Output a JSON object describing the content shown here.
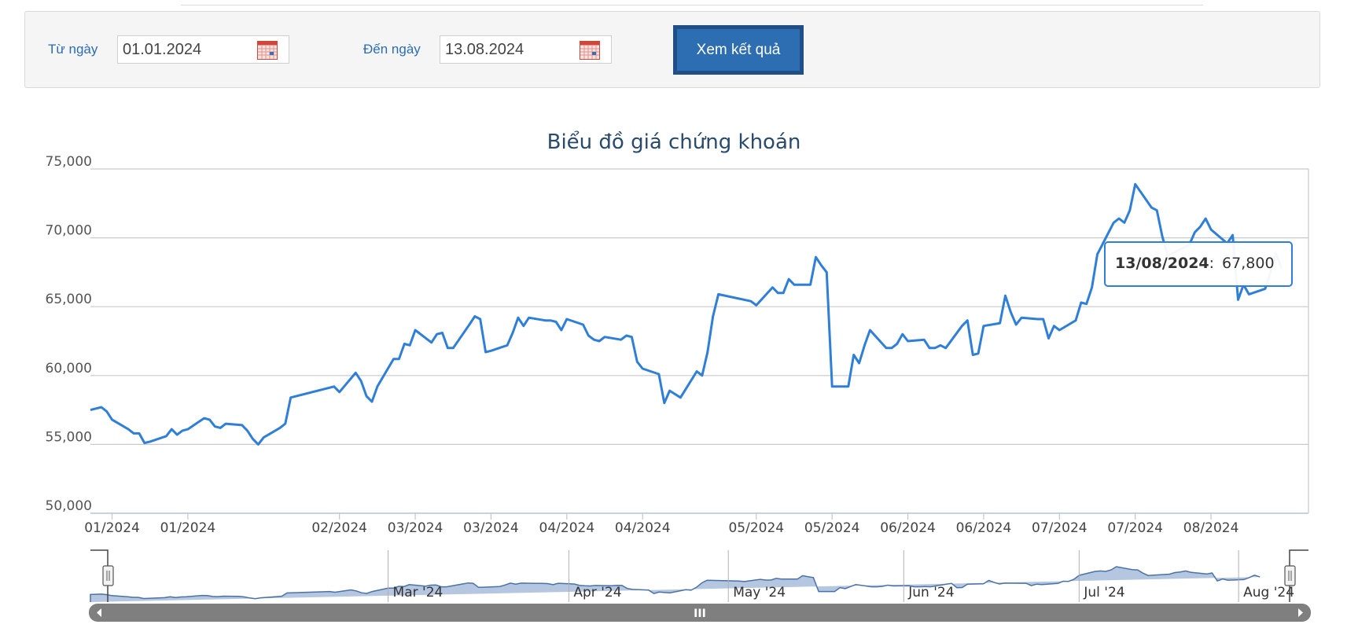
{
  "filter": {
    "from_label": "Từ ngày",
    "from_value": "01.01.2024",
    "to_label": "Đến ngày",
    "to_value": "13.08.2024",
    "submit_label": "Xem kết quả",
    "calendar_icon": "calendar-icon"
  },
  "colors": {
    "line": "#2f7ed8",
    "navigator_fill": "#b4c6e0",
    "navigator_line": "#4a72a6",
    "button": "#2d6db1",
    "title": "#2a4a6b"
  },
  "chart_data": {
    "type": "line",
    "title": "Biểu đồ giá chứng khoán",
    "xlabel": "",
    "ylabel": "",
    "ylim": [
      50000,
      75000
    ],
    "yticks": [
      50000,
      55000,
      60000,
      65000,
      70000,
      75000
    ],
    "ytick_labels": [
      "50,000",
      "55,000",
      "60,000",
      "65,000",
      "70,000",
      "75,000"
    ],
    "xticks": [
      {
        "label": "01/2024",
        "date": "2024-01-05"
      },
      {
        "label": "01/2024",
        "date": "2024-01-19"
      },
      {
        "label": "02/2024",
        "date": "2024-02-16"
      },
      {
        "label": "03/2024",
        "date": "2024-03-01"
      },
      {
        "label": "03/2024",
        "date": "2024-03-15"
      },
      {
        "label": "04/2024",
        "date": "2024-03-29"
      },
      {
        "label": "04/2024",
        "date": "2024-04-12"
      },
      {
        "label": "05/2024",
        "date": "2024-05-03"
      },
      {
        "label": "05/2024",
        "date": "2024-05-17"
      },
      {
        "label": "06/2024",
        "date": "2024-05-31"
      },
      {
        "label": "06/2024",
        "date": "2024-06-14"
      },
      {
        "label": "07/2024",
        "date": "2024-06-28"
      },
      {
        "label": "07/2024",
        "date": "2024-07-12"
      },
      {
        "label": "08/2024",
        "date": "2024-07-26"
      }
    ],
    "grid": true,
    "x": [
      "2024-01-01",
      "2024-01-02",
      "2024-01-03",
      "2024-01-04",
      "2024-01-05",
      "2024-01-08",
      "2024-01-09",
      "2024-01-10",
      "2024-01-11",
      "2024-01-12",
      "2024-01-15",
      "2024-01-16",
      "2024-01-17",
      "2024-01-18",
      "2024-01-19",
      "2024-01-22",
      "2024-01-23",
      "2024-01-24",
      "2024-01-25",
      "2024-01-26",
      "2024-01-29",
      "2024-01-30",
      "2024-01-31",
      "2024-02-01",
      "2024-02-02",
      "2024-02-05",
      "2024-02-06",
      "2024-02-07",
      "2024-02-15",
      "2024-02-16",
      "2024-02-19",
      "2024-02-20",
      "2024-02-21",
      "2024-02-22",
      "2024-02-23",
      "2024-02-26",
      "2024-02-27",
      "2024-02-28",
      "2024-02-29",
      "2024-03-01",
      "2024-03-04",
      "2024-03-05",
      "2024-03-06",
      "2024-03-07",
      "2024-03-08",
      "2024-03-11",
      "2024-03-12",
      "2024-03-13",
      "2024-03-14",
      "2024-03-15",
      "2024-03-18",
      "2024-03-19",
      "2024-03-20",
      "2024-03-21",
      "2024-03-22",
      "2024-03-25",
      "2024-03-26",
      "2024-03-27",
      "2024-03-28",
      "2024-03-29",
      "2024-04-01",
      "2024-04-02",
      "2024-04-03",
      "2024-04-04",
      "2024-04-05",
      "2024-04-08",
      "2024-04-09",
      "2024-04-10",
      "2024-04-11",
      "2024-04-12",
      "2024-04-15",
      "2024-04-16",
      "2024-04-17",
      "2024-04-19",
      "2024-04-22",
      "2024-04-23",
      "2024-04-24",
      "2024-04-25",
      "2024-04-26",
      "2024-05-02",
      "2024-05-03",
      "2024-05-06",
      "2024-05-07",
      "2024-05-08",
      "2024-05-09",
      "2024-05-10",
      "2024-05-13",
      "2024-05-14",
      "2024-05-15",
      "2024-05-16",
      "2024-05-17",
      "2024-05-20",
      "2024-05-21",
      "2024-05-22",
      "2024-05-23",
      "2024-05-24",
      "2024-05-27",
      "2024-05-28",
      "2024-05-29",
      "2024-05-30",
      "2024-05-31",
      "2024-06-03",
      "2024-06-04",
      "2024-06-05",
      "2024-06-06",
      "2024-06-07",
      "2024-06-10",
      "2024-06-11",
      "2024-06-12",
      "2024-06-13",
      "2024-06-14",
      "2024-06-17",
      "2024-06-18",
      "2024-06-19",
      "2024-06-20",
      "2024-06-21",
      "2024-06-24",
      "2024-06-25",
      "2024-06-26",
      "2024-06-27",
      "2024-06-28",
      "2024-07-01",
      "2024-07-02",
      "2024-07-03",
      "2024-07-04",
      "2024-07-05",
      "2024-07-08",
      "2024-07-09",
      "2024-07-10",
      "2024-07-11",
      "2024-07-12",
      "2024-07-15",
      "2024-07-16",
      "2024-07-17",
      "2024-07-18",
      "2024-07-19",
      "2024-07-22",
      "2024-07-23",
      "2024-07-24",
      "2024-07-25",
      "2024-07-26",
      "2024-07-29",
      "2024-07-30",
      "2024-07-31",
      "2024-08-01",
      "2024-08-02",
      "2024-08-05",
      "2024-08-06",
      "2024-08-07",
      "2024-08-08",
      "2024-08-09",
      "2024-08-12",
      "2024-08-13"
    ],
    "series": [
      {
        "values": [
          57500,
          57600,
          57700,
          57400,
          56800,
          56100,
          55800,
          55800,
          55100,
          55200,
          55600,
          56100,
          55700,
          56000,
          56100,
          56900,
          56800,
          56300,
          56200,
          56500,
          56400,
          56000,
          55400,
          55000,
          55500,
          56200,
          56500,
          58400,
          59200,
          58800,
          60200,
          59600,
          58500,
          58100,
          59200,
          61200,
          61200,
          62300,
          62200,
          63300,
          62400,
          63000,
          63100,
          62000,
          62000,
          63700,
          64300,
          64100,
          61700,
          61800,
          62200,
          63100,
          64200,
          63600,
          64200,
          64000,
          64000,
          63900,
          63300,
          64100,
          63700,
          62900,
          62600,
          62500,
          62800,
          62600,
          62900,
          62800,
          61000,
          60500,
          60100,
          58000,
          58900,
          58400,
          60300,
          60000,
          61700,
          64300,
          65900,
          65400,
          65100,
          66400,
          66000,
          66000,
          67000,
          66600,
          66600,
          68600,
          68000,
          67500,
          59200,
          59200,
          61500,
          60900,
          62200,
          63300,
          62000,
          62000,
          62300,
          63000,
          62500,
          62600,
          62000,
          62000,
          62200,
          62000,
          63600,
          64000,
          61500,
          61600,
          63600,
          63800,
          65800,
          64600,
          63700,
          64200,
          64100,
          64100,
          62700,
          63600,
          63300,
          64000,
          65300,
          65200,
          66400,
          68800,
          71100,
          71400,
          71100,
          72000,
          73900,
          72200,
          72000,
          70100,
          68700,
          68900,
          69500,
          70400,
          70800,
          71400,
          70600,
          69600,
          70200,
          65500,
          66600,
          65900,
          66300,
          67500,
          68900,
          67800
        ]
      }
    ],
    "tooltip": {
      "date": "13/08/2024",
      "separator": ":",
      "value": "67,800"
    },
    "navigator_labels": [
      "Mar '24",
      "Apr '24",
      "May '24",
      "Jun '24",
      "Jul '24",
      "Aug '24"
    ],
    "scrollbar_grip": "III"
  }
}
